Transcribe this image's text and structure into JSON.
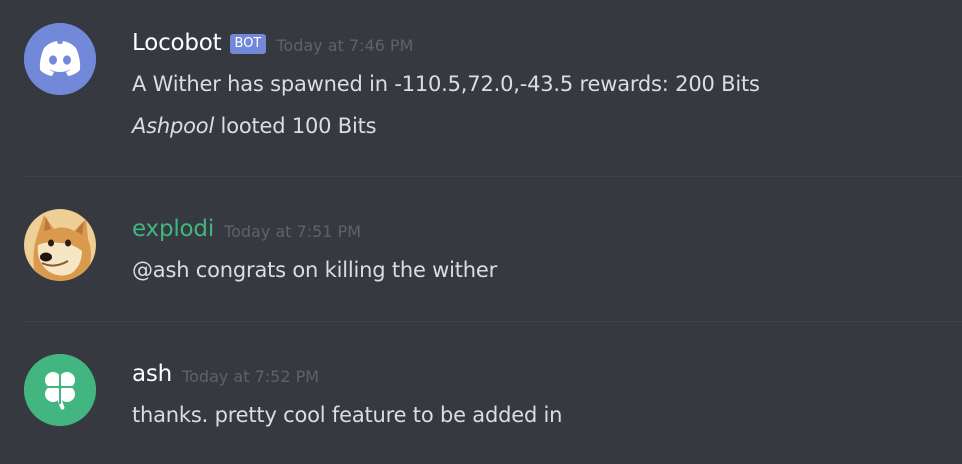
{
  "colors": {
    "background": "#36393f",
    "username_default": "#ffffff",
    "username_green": "#43b581",
    "bot_tag": "#7289da",
    "timestamp": "#5f6269",
    "message_text": "#dcddde",
    "discord_avatar_bg": "#7289da",
    "clover_avatar_bg": "#43b581"
  },
  "messages": [
    {
      "username": "Locobot",
      "bot_tag": "BOT",
      "timestamp": "Today at 7:46 PM",
      "avatar_icon": "discord-logo-icon",
      "lines": [
        "A Wither has spawned in -110.5,72.0,-43.5 rewards: 200 Bits"
      ],
      "loot_line": {
        "user": "Ashpool",
        "rest": " looted 100 Bits"
      }
    },
    {
      "username": "explodi",
      "timestamp": "Today at 7:51 PM",
      "avatar_icon": "doge-avatar-icon",
      "lines": [
        "@ash congrats on killing the wither"
      ]
    },
    {
      "username": "ash",
      "timestamp": "Today at 7:52 PM",
      "avatar_icon": "clover-avatar-icon",
      "lines": [
        "thanks. pretty cool feature to be added in"
      ]
    }
  ]
}
